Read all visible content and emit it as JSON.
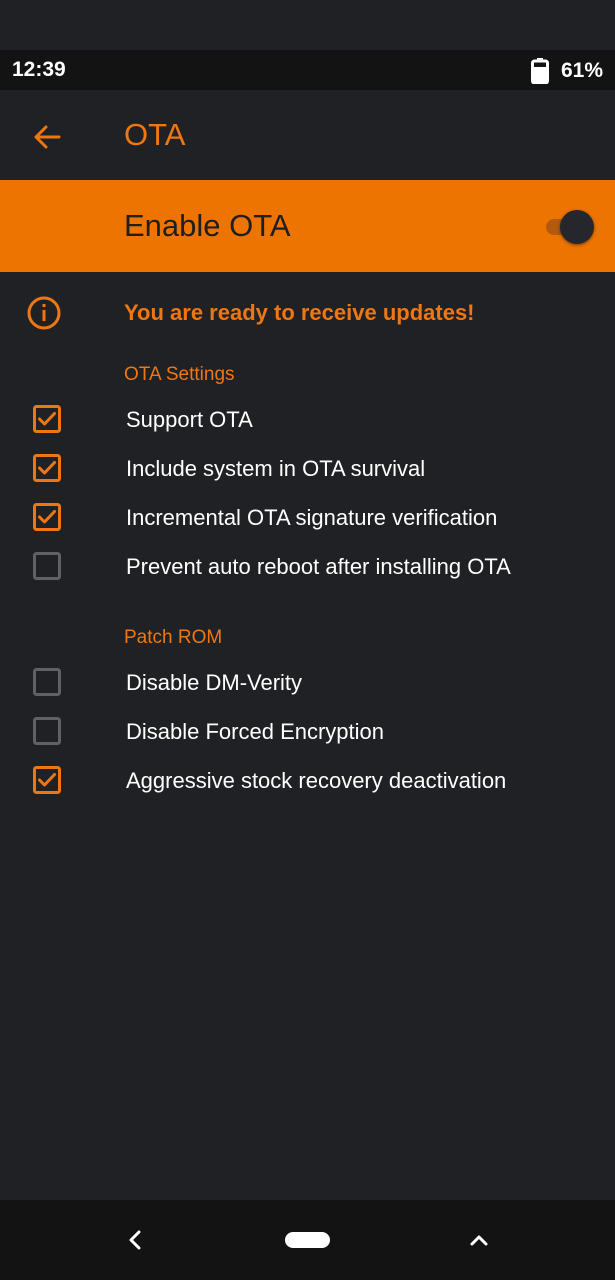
{
  "status_bar": {
    "time": "12:39",
    "battery_percent": "61%",
    "battery_icon": "battery-icon"
  },
  "app_bar": {
    "title": "OTA",
    "back_icon": "arrow-left-icon"
  },
  "enable_banner": {
    "label": "Enable OTA",
    "toggle_on": true
  },
  "info": {
    "text": "You are ready to receive updates!",
    "icon": "info-icon"
  },
  "sections": {
    "ota_settings": {
      "header": "OTA Settings",
      "options": [
        {
          "label": "Support OTA",
          "checked": true
        },
        {
          "label": "Include system in OTA survival",
          "checked": true
        },
        {
          "label": "Incremental OTA signature verification",
          "checked": true
        },
        {
          "label": "Prevent auto reboot after installing OTA",
          "checked": false
        }
      ]
    },
    "patch_rom": {
      "header": "Patch ROM",
      "options": [
        {
          "label": "Disable DM-Verity",
          "checked": false
        },
        {
          "label": "Disable Forced Encryption",
          "checked": false
        },
        {
          "label": "Aggressive stock recovery deactivation",
          "checked": true
        }
      ]
    }
  },
  "nav_bar": {
    "back_icon": "nav-back-icon",
    "home_icon": "nav-home-pill-icon",
    "recents_icon": "chevron-up-icon"
  },
  "colors": {
    "accent": "#ee7402",
    "background": "#202124",
    "status_bar": "#131313",
    "text": "#ffffff"
  }
}
